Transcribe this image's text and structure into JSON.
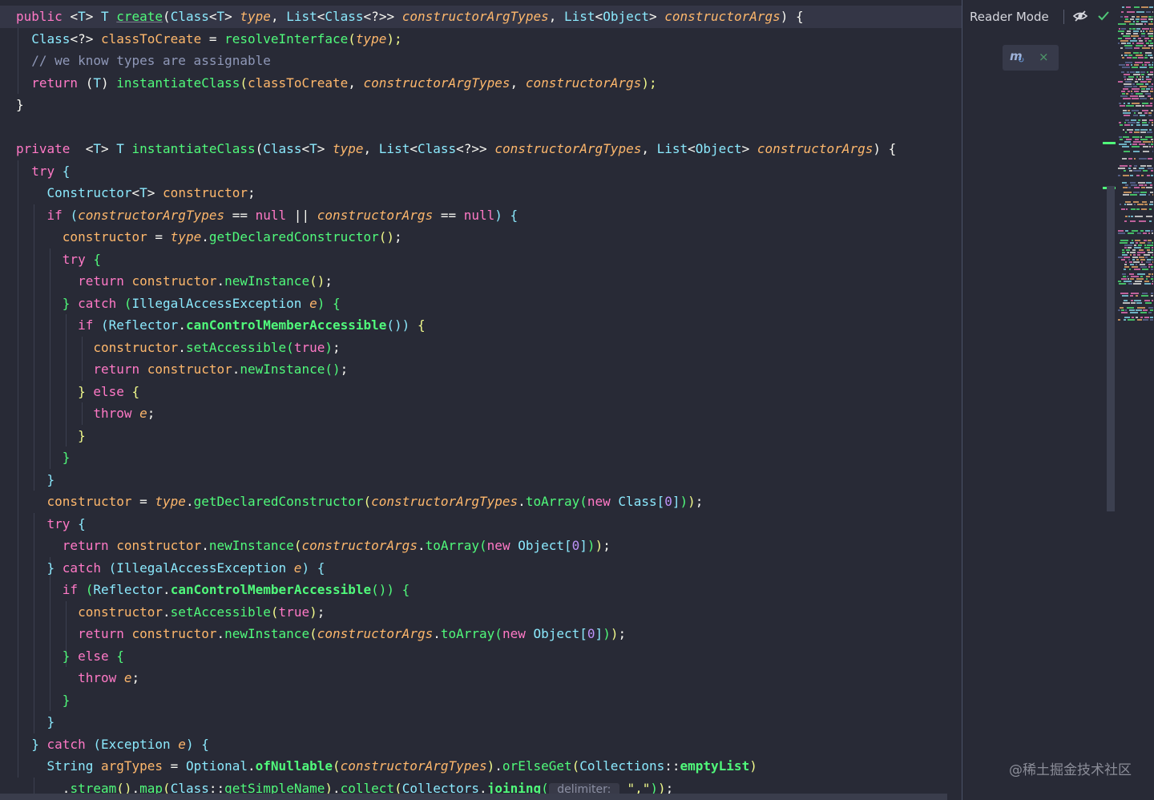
{
  "editor": {
    "lines": [
      [
        [
          "public ",
          "kw"
        ],
        [
          "<",
          "plain"
        ],
        [
          "T",
          "type"
        ],
        [
          "> ",
          "plain"
        ],
        [
          "T ",
          "type"
        ],
        [
          "create",
          "fn"
        ],
        [
          "(",
          "plain"
        ],
        [
          "Class",
          "type"
        ],
        [
          "<",
          "plain"
        ],
        [
          "T",
          "type"
        ],
        [
          "> ",
          "plain"
        ],
        [
          "type",
          "param"
        ],
        [
          ", ",
          "plain"
        ],
        [
          "List",
          "type"
        ],
        [
          "<",
          "plain"
        ],
        [
          "Class",
          "type"
        ],
        [
          "<?>> ",
          "plain"
        ],
        [
          "constructorArgTypes",
          "param"
        ],
        [
          ", ",
          "plain"
        ],
        [
          "List",
          "type"
        ],
        [
          "<",
          "plain"
        ],
        [
          "Object",
          "type"
        ],
        [
          "> ",
          "plain"
        ],
        [
          "constructorArgs",
          "param"
        ],
        [
          ") {",
          "plain"
        ]
      ],
      [
        [
          "  ",
          "plain"
        ],
        [
          "Class",
          "type"
        ],
        [
          "<?> ",
          "plain"
        ],
        [
          "classToCreate",
          "field"
        ],
        [
          " = ",
          "plain"
        ],
        [
          "resolveInterface",
          "fn"
        ],
        [
          "(",
          "p1"
        ],
        [
          "type",
          "param"
        ],
        [
          ");",
          "p1"
        ]
      ],
      [
        [
          "  ",
          "plain"
        ],
        [
          "// we know types are assignable",
          "com"
        ]
      ],
      [
        [
          "  ",
          "plain"
        ],
        [
          "return ",
          "kw"
        ],
        [
          "(",
          "plain"
        ],
        [
          "T",
          "type"
        ],
        [
          ") ",
          "plain"
        ],
        [
          "instantiateClass",
          "fn"
        ],
        [
          "(",
          "p1"
        ],
        [
          "classToCreate",
          "field"
        ],
        [
          ", ",
          "plain"
        ],
        [
          "constructorArgTypes",
          "param"
        ],
        [
          ", ",
          "plain"
        ],
        [
          "constructorArgs",
          "param"
        ],
        [
          ");",
          "p1"
        ]
      ],
      [
        [
          "}",
          "plain"
        ]
      ],
      [],
      [
        [
          "private  ",
          "kw"
        ],
        [
          "<",
          "plain"
        ],
        [
          "T",
          "type"
        ],
        [
          "> ",
          "plain"
        ],
        [
          "T ",
          "type"
        ],
        [
          "instantiateClass",
          "fn"
        ],
        [
          "(",
          "plain"
        ],
        [
          "Class",
          "type"
        ],
        [
          "<",
          "plain"
        ],
        [
          "T",
          "type"
        ],
        [
          "> ",
          "plain"
        ],
        [
          "type",
          "param"
        ],
        [
          ", ",
          "plain"
        ],
        [
          "List",
          "type"
        ],
        [
          "<",
          "plain"
        ],
        [
          "Class",
          "type"
        ],
        [
          "<?>> ",
          "plain"
        ],
        [
          "constructorArgTypes",
          "param"
        ],
        [
          ", ",
          "plain"
        ],
        [
          "List",
          "type"
        ],
        [
          "<",
          "plain"
        ],
        [
          "Object",
          "type"
        ],
        [
          "> ",
          "plain"
        ],
        [
          "constructorArgs",
          "param"
        ],
        [
          ") {",
          "plain"
        ]
      ],
      [
        [
          "  ",
          "plain"
        ],
        [
          "try ",
          "kw"
        ],
        [
          "{",
          "p3"
        ]
      ],
      [
        [
          "    ",
          "plain"
        ],
        [
          "Constructor",
          "type"
        ],
        [
          "<",
          "plain"
        ],
        [
          "T",
          "type"
        ],
        [
          "> ",
          "plain"
        ],
        [
          "constructor",
          "field"
        ],
        [
          ";",
          "plain"
        ]
      ],
      [
        [
          "    ",
          "plain"
        ],
        [
          "if ",
          "kw"
        ],
        [
          "(",
          "p3"
        ],
        [
          "constructorArgTypes",
          "param"
        ],
        [
          " == ",
          "plain"
        ],
        [
          "null",
          "kw"
        ],
        [
          " || ",
          "plain"
        ],
        [
          "constructorArgs",
          "param"
        ],
        [
          " == ",
          "plain"
        ],
        [
          "null",
          "kw"
        ],
        [
          ") {",
          "p3"
        ]
      ],
      [
        [
          "      ",
          "plain"
        ],
        [
          "constructor",
          "field"
        ],
        [
          " = ",
          "plain"
        ],
        [
          "type",
          "param"
        ],
        [
          ".",
          "plain"
        ],
        [
          "getDeclaredConstructor",
          "fn"
        ],
        [
          "()",
          "p1"
        ],
        [
          ";",
          "plain"
        ]
      ],
      [
        [
          "      ",
          "plain"
        ],
        [
          "try ",
          "kw"
        ],
        [
          "{",
          "p2"
        ]
      ],
      [
        [
          "        ",
          "plain"
        ],
        [
          "return ",
          "kw"
        ],
        [
          "constructor",
          "field"
        ],
        [
          ".",
          "plain"
        ],
        [
          "newInstance",
          "fn"
        ],
        [
          "()",
          "p1"
        ],
        [
          ";",
          "plain"
        ]
      ],
      [
        [
          "      ",
          "plain"
        ],
        [
          "} ",
          "p2"
        ],
        [
          "catch ",
          "kw"
        ],
        [
          "(",
          "p2"
        ],
        [
          "IllegalAccessException ",
          "type"
        ],
        [
          "e",
          "param"
        ],
        [
          ") {",
          "p2"
        ]
      ],
      [
        [
          "        ",
          "plain"
        ],
        [
          "if ",
          "kw"
        ],
        [
          "(",
          "p3"
        ],
        [
          "Reflector",
          "type"
        ],
        [
          ".",
          "plain"
        ],
        [
          "canControlMemberAccessible",
          "fn bold"
        ],
        [
          "())",
          "p3"
        ],
        [
          " {",
          "p1"
        ]
      ],
      [
        [
          "          ",
          "plain"
        ],
        [
          "constructor",
          "field"
        ],
        [
          ".",
          "plain"
        ],
        [
          "setAccessible",
          "fn"
        ],
        [
          "(",
          "p2"
        ],
        [
          "true",
          "kw"
        ],
        [
          ")",
          "p2"
        ],
        [
          ";",
          "plain"
        ]
      ],
      [
        [
          "          ",
          "plain"
        ],
        [
          "return ",
          "kw"
        ],
        [
          "constructor",
          "field"
        ],
        [
          ".",
          "plain"
        ],
        [
          "newInstance",
          "fn"
        ],
        [
          "()",
          "p2"
        ],
        [
          ";",
          "plain"
        ]
      ],
      [
        [
          "        ",
          "plain"
        ],
        [
          "} ",
          "p1"
        ],
        [
          "else ",
          "kw"
        ],
        [
          "{",
          "p1"
        ]
      ],
      [
        [
          "          ",
          "plain"
        ],
        [
          "throw ",
          "kw"
        ],
        [
          "e",
          "param"
        ],
        [
          ";",
          "plain"
        ]
      ],
      [
        [
          "        ",
          "plain"
        ],
        [
          "}",
          "p1"
        ]
      ],
      [
        [
          "      ",
          "plain"
        ],
        [
          "}",
          "p2"
        ]
      ],
      [
        [
          "    ",
          "plain"
        ],
        [
          "}",
          "p3"
        ]
      ],
      [
        [
          "    ",
          "plain"
        ],
        [
          "constructor",
          "field"
        ],
        [
          " = ",
          "plain"
        ],
        [
          "type",
          "param"
        ],
        [
          ".",
          "plain"
        ],
        [
          "getDeclaredConstructor",
          "fn"
        ],
        [
          "(",
          "p1"
        ],
        [
          "constructorArgTypes",
          "param"
        ],
        [
          ".",
          "plain"
        ],
        [
          "toArray",
          "fn"
        ],
        [
          "(",
          "p2"
        ],
        [
          "new ",
          "kw"
        ],
        [
          "Class",
          "type"
        ],
        [
          "[",
          "p3"
        ],
        [
          "0",
          "num"
        ],
        [
          "]",
          "p3"
        ],
        [
          ")",
          "p2"
        ],
        [
          ")",
          "p1"
        ],
        [
          ";",
          "plain"
        ]
      ],
      [
        [
          "    ",
          "plain"
        ],
        [
          "try ",
          "kw"
        ],
        [
          "{",
          "p3"
        ]
      ],
      [
        [
          "      ",
          "plain"
        ],
        [
          "return ",
          "kw"
        ],
        [
          "constructor",
          "field"
        ],
        [
          ".",
          "plain"
        ],
        [
          "newInstance",
          "fn"
        ],
        [
          "(",
          "p1"
        ],
        [
          "constructorArgs",
          "param"
        ],
        [
          ".",
          "plain"
        ],
        [
          "toArray",
          "fn"
        ],
        [
          "(",
          "p2"
        ],
        [
          "new ",
          "kw"
        ],
        [
          "Object",
          "type"
        ],
        [
          "[",
          "p3"
        ],
        [
          "0",
          "num"
        ],
        [
          "]",
          "p3"
        ],
        [
          ")",
          "p2"
        ],
        [
          ")",
          "p1"
        ],
        [
          ";",
          "plain"
        ]
      ],
      [
        [
          "    ",
          "plain"
        ],
        [
          "} ",
          "p3"
        ],
        [
          "catch ",
          "kw"
        ],
        [
          "(",
          "p3"
        ],
        [
          "IllegalAccessException ",
          "type"
        ],
        [
          "e",
          "param"
        ],
        [
          ") {",
          "p3"
        ]
      ],
      [
        [
          "      ",
          "plain"
        ],
        [
          "if ",
          "kw"
        ],
        [
          "(",
          "p2"
        ],
        [
          "Reflector",
          "type"
        ],
        [
          ".",
          "plain"
        ],
        [
          "canControlMemberAccessible",
          "fn bold"
        ],
        [
          "())",
          "p2"
        ],
        [
          " {",
          "p2"
        ]
      ],
      [
        [
          "        ",
          "plain"
        ],
        [
          "constructor",
          "field"
        ],
        [
          ".",
          "plain"
        ],
        [
          "setAccessible",
          "fn"
        ],
        [
          "(",
          "p1"
        ],
        [
          "true",
          "kw"
        ],
        [
          ")",
          "p1"
        ],
        [
          ";",
          "plain"
        ]
      ],
      [
        [
          "        ",
          "plain"
        ],
        [
          "return ",
          "kw"
        ],
        [
          "constructor",
          "field"
        ],
        [
          ".",
          "plain"
        ],
        [
          "newInstance",
          "fn"
        ],
        [
          "(",
          "p1"
        ],
        [
          "constructorArgs",
          "param"
        ],
        [
          ".",
          "plain"
        ],
        [
          "toArray",
          "fn"
        ],
        [
          "(",
          "p2"
        ],
        [
          "new ",
          "kw"
        ],
        [
          "Object",
          "type"
        ],
        [
          "[",
          "p3"
        ],
        [
          "0",
          "num"
        ],
        [
          "]",
          "p3"
        ],
        [
          ")",
          "p2"
        ],
        [
          ")",
          "p1"
        ],
        [
          ";",
          "plain"
        ]
      ],
      [
        [
          "      ",
          "plain"
        ],
        [
          "} ",
          "p2"
        ],
        [
          "else ",
          "kw"
        ],
        [
          "{",
          "p2"
        ]
      ],
      [
        [
          "        ",
          "plain"
        ],
        [
          "throw ",
          "kw"
        ],
        [
          "e",
          "param"
        ],
        [
          ";",
          "plain"
        ]
      ],
      [
        [
          "      ",
          "plain"
        ],
        [
          "}",
          "p2"
        ]
      ],
      [
        [
          "    ",
          "plain"
        ],
        [
          "}",
          "p3"
        ]
      ],
      [
        [
          "  ",
          "plain"
        ],
        [
          "} ",
          "p3"
        ],
        [
          "catch ",
          "kw"
        ],
        [
          "(",
          "p3"
        ],
        [
          "Exception ",
          "type"
        ],
        [
          "e",
          "param"
        ],
        [
          ") {",
          "p3"
        ]
      ],
      [
        [
          "    ",
          "plain"
        ],
        [
          "String ",
          "type"
        ],
        [
          "argTypes",
          "field"
        ],
        [
          " = ",
          "plain"
        ],
        [
          "Optional",
          "type"
        ],
        [
          ".",
          "plain"
        ],
        [
          "ofNullable",
          "fn bold"
        ],
        [
          "(",
          "p1"
        ],
        [
          "constructorArgTypes",
          "param"
        ],
        [
          ")",
          "p1"
        ],
        [
          ".",
          "plain"
        ],
        [
          "orElseGet",
          "fn"
        ],
        [
          "(",
          "p1"
        ],
        [
          "Collections",
          "type"
        ],
        [
          "::",
          "plain"
        ],
        [
          "emptyList",
          "fn bold"
        ],
        [
          ")",
          "p1"
        ]
      ],
      [
        [
          "      .",
          "plain"
        ],
        [
          "stream",
          "fn"
        ],
        [
          "()",
          "p1"
        ],
        [
          ".",
          "plain"
        ],
        [
          "map",
          "fn"
        ],
        [
          "(",
          "p1"
        ],
        [
          "Class",
          "type"
        ],
        [
          "::",
          "plain"
        ],
        [
          "getSimpleName",
          "fn"
        ],
        [
          ")",
          "p1"
        ],
        [
          ".",
          "plain"
        ],
        [
          "collect",
          "fn"
        ],
        [
          "(",
          "p1"
        ],
        [
          "Collectors",
          "type"
        ],
        [
          ".",
          "plain"
        ],
        [
          "joining",
          "fn bold"
        ],
        [
          "(",
          "p2"
        ],
        [
          " delimiter: ",
          "hint"
        ],
        [
          " \",\"",
          "str"
        ],
        [
          ")",
          "p2"
        ],
        [
          ")",
          "p1"
        ],
        [
          ";",
          "plain"
        ]
      ]
    ]
  },
  "reader_mode": {
    "label": "Reader Mode"
  },
  "maven_widget": {
    "icon_label": "m",
    "refresh_glyph": "↻",
    "close_glyph": "×"
  },
  "watermark": "@稀土掘金技术社区",
  "colors": {
    "background": "#282a36",
    "keyword": "#ff79c6",
    "type": "#8be9fd",
    "function": "#50fa7b",
    "parameter": "#ffb86c",
    "number": "#bd93f9",
    "comment": "#8f98b8"
  }
}
